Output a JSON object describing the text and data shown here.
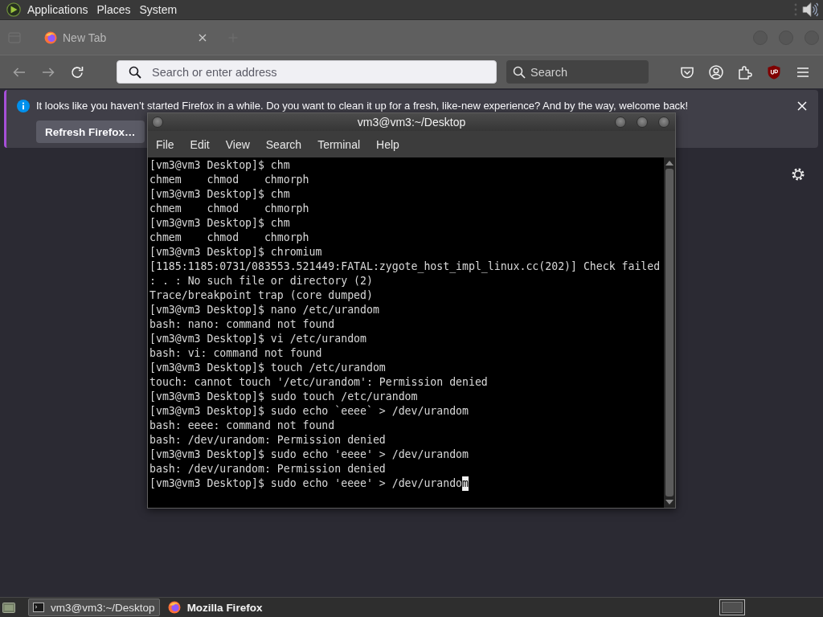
{
  "top_panel": {
    "menus": [
      "Applications",
      "Places",
      "System"
    ]
  },
  "browser": {
    "tabs": [
      {
        "label": "New Tab"
      }
    ],
    "nav_buttons": [
      {
        "kind": "back",
        "disabled": true
      },
      {
        "kind": "forward",
        "disabled": true
      },
      {
        "kind": "reload",
        "disabled": false
      }
    ],
    "address_bar": {
      "placeholder": "Search or enter address"
    },
    "search_box": {
      "placeholder": "Search"
    },
    "notification": {
      "message": "It looks like you haven’t started Firefox in a while. Do you want to clean it up for a fresh, like-new experience? And by the way, welcome back!",
      "button": "Refresh Firefox…"
    }
  },
  "terminal": {
    "title": "vm3@vm3:~/Desktop",
    "menus": [
      "File",
      "Edit",
      "View",
      "Search",
      "Terminal",
      "Help"
    ],
    "lines": [
      "[vm3@vm3 Desktop]$ chm",
      "chmem    chmod    chmorph",
      "[vm3@vm3 Desktop]$ chm",
      "chmem    chmod    chmorph",
      "[vm3@vm3 Desktop]$ chm",
      "chmem    chmod    chmorph",
      "[vm3@vm3 Desktop]$ chromium",
      "[1185:1185:0731/083553.521449:FATAL:zygote_host_impl_linux.cc(202)] Check failed",
      ": . : No such file or directory (2)",
      "Trace/breakpoint trap (core dumped)",
      "[vm3@vm3 Desktop]$ nano /etc/urandom",
      "bash: nano: command not found",
      "[vm3@vm3 Desktop]$ vi /etc/urandom",
      "bash: vi: command not found",
      "[vm3@vm3 Desktop]$ touch /etc/urandom",
      "touch: cannot touch '/etc/urandom': Permission denied",
      "[vm3@vm3 Desktop]$ sudo touch /etc/urandom",
      "[vm3@vm3 Desktop]$ sudo echo `eeee` > /dev/urandom",
      "bash: eeee: command not found",
      "bash: /dev/urandom: Permission denied",
      "[vm3@vm3 Desktop]$ sudo echo 'eeee' > /dev/urandom",
      "bash: /dev/urandom: Permission denied"
    ],
    "input_line": {
      "text": "[vm3@vm3 Desktop]$ sudo echo 'eeee' > /dev/urando",
      "cursor": "m"
    }
  },
  "taskbar": {
    "tasks": [
      {
        "kind": "terminal",
        "label": "vm3@vm3:~/Desktop",
        "selected": true,
        "urgent": false
      },
      {
        "kind": "browser",
        "label": "Mozilla Firefox",
        "selected": false,
        "urgent": true
      }
    ]
  }
}
